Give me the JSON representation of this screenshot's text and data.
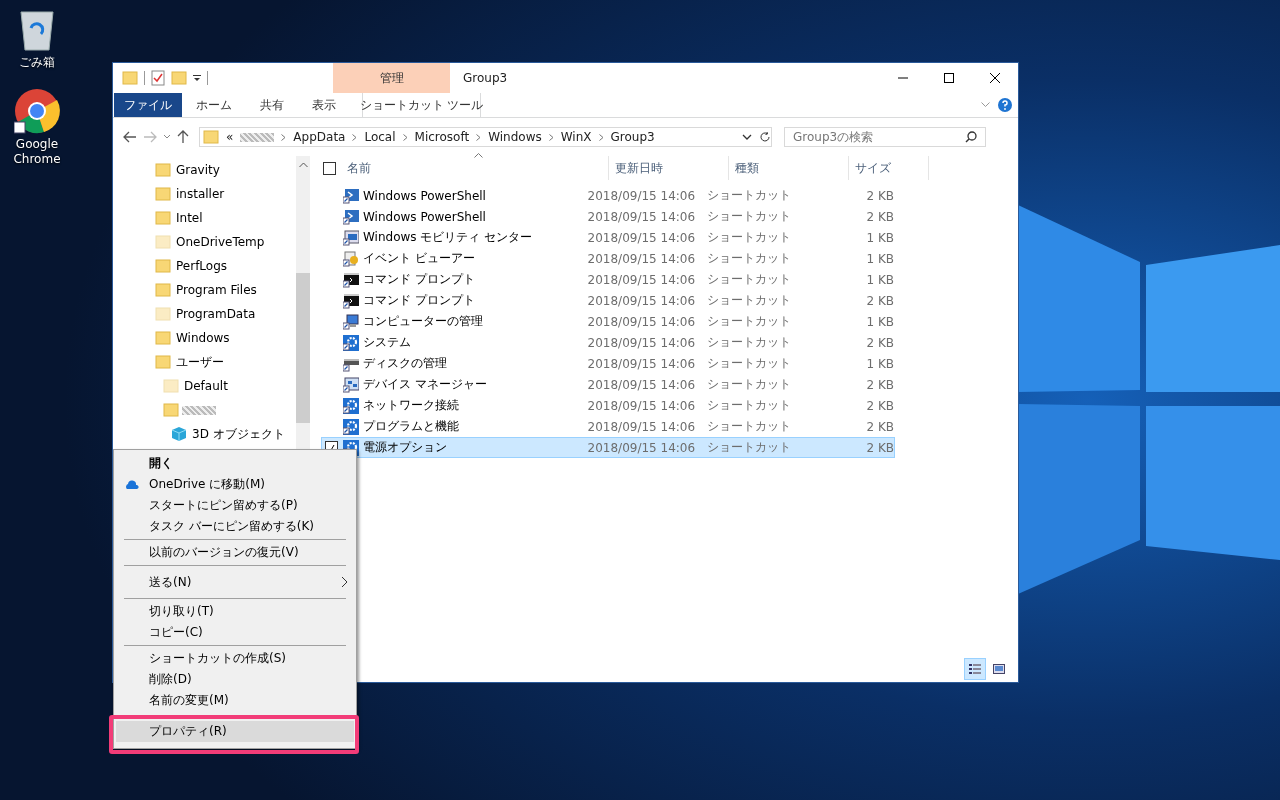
{
  "desktop_icons": [
    {
      "label": "ごみ箱",
      "kind": "recycle"
    },
    {
      "label": "Google Chrome",
      "kind": "browser"
    }
  ],
  "window": {
    "title": "Group3",
    "contextual_group": {
      "label": "管理",
      "tab": "ショートカット ツール"
    },
    "ribbon_tabs": [
      {
        "label": "ファイル",
        "kind": "file"
      },
      {
        "label": "ホーム",
        "kind": "tab"
      },
      {
        "label": "共有",
        "kind": "tab"
      },
      {
        "label": "表示",
        "kind": "tab"
      }
    ],
    "address": {
      "segments": [
        {
          "label": "«",
          "kind": "text"
        },
        {
          "kind": "masked"
        },
        {
          "label": "AppData",
          "kind": "text"
        },
        {
          "label": "Local",
          "kind": "text"
        },
        {
          "label": "Microsoft",
          "kind": "text"
        },
        {
          "label": "Windows",
          "kind": "text"
        },
        {
          "label": "WinX",
          "kind": "text"
        },
        {
          "label": "Group3",
          "kind": "text"
        }
      ]
    },
    "search": {
      "placeholder": "Group3の検索"
    },
    "nav_tree": [
      {
        "label": "Gravity",
        "hidden": false,
        "kind": "folder"
      },
      {
        "label": "installer",
        "hidden": false,
        "kind": "folder"
      },
      {
        "label": "Intel",
        "hidden": false,
        "kind": "folder"
      },
      {
        "label": "OneDriveTemp",
        "hidden": true,
        "kind": "folder"
      },
      {
        "label": "PerfLogs",
        "hidden": false,
        "kind": "folder"
      },
      {
        "label": "Program Files",
        "hidden": false,
        "kind": "folder"
      },
      {
        "label": "ProgramData",
        "hidden": true,
        "kind": "folder"
      },
      {
        "label": "Windows",
        "hidden": false,
        "kind": "folder"
      },
      {
        "label": "ユーザー",
        "hidden": false,
        "kind": "folder",
        "children": [
          {
            "label": "Default",
            "hidden": true,
            "kind": "folder"
          },
          {
            "hidden": false,
            "kind": "masked",
            "children": [
              {
                "label": "3D オブジェクト",
                "kind": "cube"
              }
            ]
          }
        ]
      }
    ],
    "select_all": {
      "checked": false
    },
    "columns": [
      {
        "label": "名前",
        "sorted": true
      },
      {
        "label": "更新日時",
        "sorted": false
      },
      {
        "label": "種類",
        "sorted": false
      },
      {
        "label": "サイズ",
        "sorted": false
      }
    ],
    "rows": [
      {
        "name": "Windows PowerShell",
        "date": "2018/09/15 14:06",
        "type": "ショートカット",
        "size": "2 KB",
        "kind": "shell",
        "selected": false
      },
      {
        "name": "Windows PowerShell",
        "date": "2018/09/15 14:06",
        "type": "ショートカット",
        "size": "2 KB",
        "kind": "shell",
        "selected": false
      },
      {
        "name": "Windows モビリティ センター",
        "date": "2018/09/15 14:06",
        "type": "ショートカット",
        "size": "1 KB",
        "kind": "monitor",
        "selected": false
      },
      {
        "name": "イベント ビューアー",
        "date": "2018/09/15 14:06",
        "type": "ショートカット",
        "size": "1 KB",
        "kind": "log",
        "selected": false
      },
      {
        "name": "コマンド プロンプト",
        "date": "2018/09/15 14:06",
        "type": "ショートカット",
        "size": "1 KB",
        "kind": "terminal",
        "selected": false
      },
      {
        "name": "コマンド プロンプト",
        "date": "2018/09/15 14:06",
        "type": "ショートカット",
        "size": "2 KB",
        "kind": "terminal",
        "selected": false
      },
      {
        "name": "コンピューターの管理",
        "date": "2018/09/15 14:06",
        "type": "ショートカット",
        "size": "1 KB",
        "kind": "computer",
        "selected": false
      },
      {
        "name": "システム",
        "date": "2018/09/15 14:06",
        "type": "ショートカット",
        "size": "2 KB",
        "kind": "gear",
        "selected": false
      },
      {
        "name": "ディスクの管理",
        "date": "2018/09/15 14:06",
        "type": "ショートカット",
        "size": "1 KB",
        "kind": "disk",
        "selected": false
      },
      {
        "name": "デバイス マネージャー",
        "date": "2018/09/15 14:06",
        "type": "ショートカット",
        "size": "2 KB",
        "kind": "device",
        "selected": false
      },
      {
        "name": "ネットワーク接続",
        "date": "2018/09/15 14:06",
        "type": "ショートカット",
        "size": "2 KB",
        "kind": "gear",
        "selected": false
      },
      {
        "name": "プログラムと機能",
        "date": "2018/09/15 14:06",
        "type": "ショートカット",
        "size": "2 KB",
        "kind": "gear",
        "selected": false
      },
      {
        "name": "電源オプション",
        "date": "2018/09/15 14:06",
        "type": "ショートカット",
        "size": "2 KB",
        "kind": "gear",
        "selected": true
      }
    ],
    "view_buttons": [
      {
        "kind": "details",
        "selected": true
      },
      {
        "kind": "large",
        "selected": false
      }
    ]
  },
  "context_menu": {
    "sections": [
      {
        "items": [
          {
            "label": "開く",
            "bold": true,
            "kind": "plain"
          },
          {
            "label": "OneDrive に移動(M)",
            "bold": false,
            "kind": "cloud"
          },
          {
            "label": "スタートにピン留めする(P)",
            "bold": false,
            "kind": "plain"
          },
          {
            "label": "タスク バーにピン留めする(K)",
            "bold": false,
            "kind": "plain"
          }
        ]
      },
      {
        "items": [
          {
            "label": "以前のバージョンの復元(V)",
            "bold": false,
            "kind": "plain"
          }
        ]
      },
      {
        "items": [
          {
            "label": "送る(N)",
            "bold": false,
            "kind": "submenu"
          }
        ]
      },
      {
        "items": [
          {
            "label": "切り取り(T)",
            "bold": false,
            "kind": "plain"
          },
          {
            "label": "コピー(C)",
            "bold": false,
            "kind": "plain"
          }
        ]
      },
      {
        "items": [
          {
            "label": "ショートカットの作成(S)",
            "bold": false,
            "kind": "plain"
          },
          {
            "label": "削除(D)",
            "bold": false,
            "kind": "plain"
          },
          {
            "label": "名前の変更(M)",
            "bold": false,
            "kind": "plain"
          }
        ]
      },
      {
        "items": [
          {
            "label": "プロパティ(R)",
            "bold": false,
            "kind": "plain",
            "selected": true,
            "annotated": true
          }
        ]
      }
    ]
  }
}
